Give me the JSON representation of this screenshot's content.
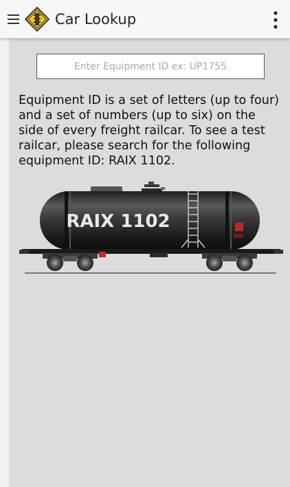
{
  "app_bar": {
    "title": "Car Lookup",
    "menu_icon": "hamburger-menu-icon",
    "logo_icon": "railroad-crossing-diamond-icon",
    "overflow_icon": "more-vertical-icon"
  },
  "search": {
    "placeholder": "Enter Equipment ID ex: UP1755",
    "value": ""
  },
  "info": {
    "text": "Equipment ID is a set of letters (up to four) and a set of numbers (up to six) on the side of every freight railcar. To see a test railcar, please search for the following equipment ID: RAIX 1102."
  },
  "railcar": {
    "marking": "RAIX 1102"
  },
  "colors": {
    "background": "#dcdcdc",
    "app_bar": "#f7f7f7",
    "logo_yellow": "#f5c518",
    "tank_dark": "#2a2a2a"
  }
}
